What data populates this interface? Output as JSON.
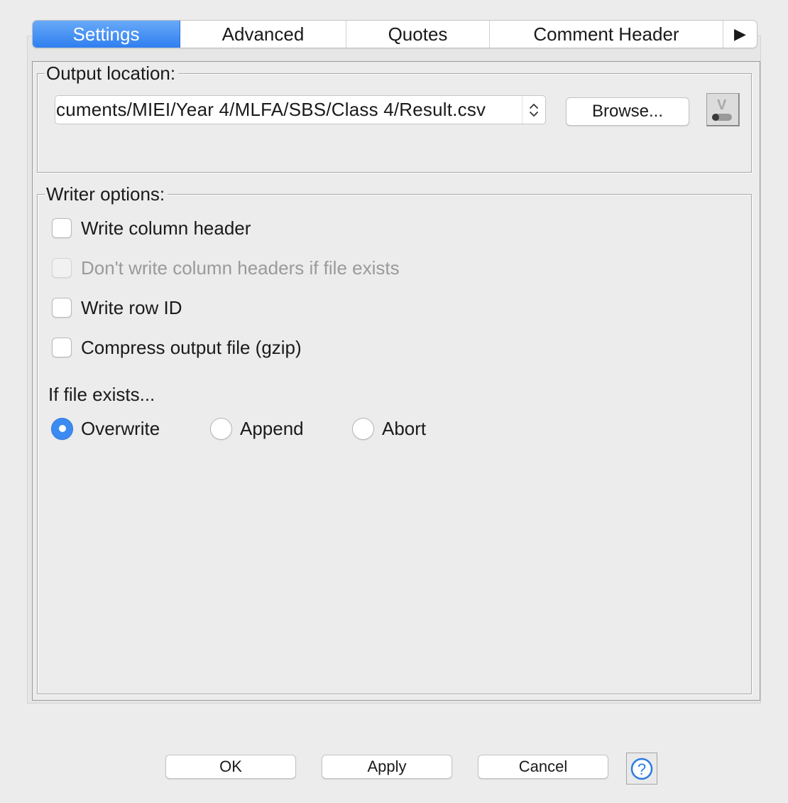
{
  "tabs": {
    "settings": "Settings",
    "advanced": "Advanced",
    "quotes": "Quotes",
    "comment_header": "Comment Header",
    "more": "▶"
  },
  "output": {
    "legend": "Output location:",
    "path": "cuments/MIEI/Year 4/MLFA/SBS/Class 4/Result.csv",
    "combo_arrows": "⌃⌄",
    "browse": "Browse...",
    "flow_variable_letter": "V"
  },
  "writer": {
    "legend": "Writer options:",
    "write_column_header": "Write column header",
    "dont_write_headers": "Don't write column headers if file exists",
    "write_row_id": "Write row ID",
    "compress": "Compress output file (gzip)",
    "if_file_exists": "If file exists...",
    "overwrite": "Overwrite",
    "append": "Append",
    "abort": "Abort"
  },
  "buttons": {
    "ok": "OK",
    "apply": "Apply",
    "cancel": "Cancel",
    "help": "?"
  },
  "colors": {
    "accent": "#3b8bf2",
    "tab_active": "#2f7ff0"
  },
  "state": {
    "active_tab": "Settings",
    "selected_radio": "Overwrite",
    "write_column_header_checked": false,
    "dont_write_headers_enabled": false,
    "write_row_id_checked": false,
    "compress_checked": false
  }
}
